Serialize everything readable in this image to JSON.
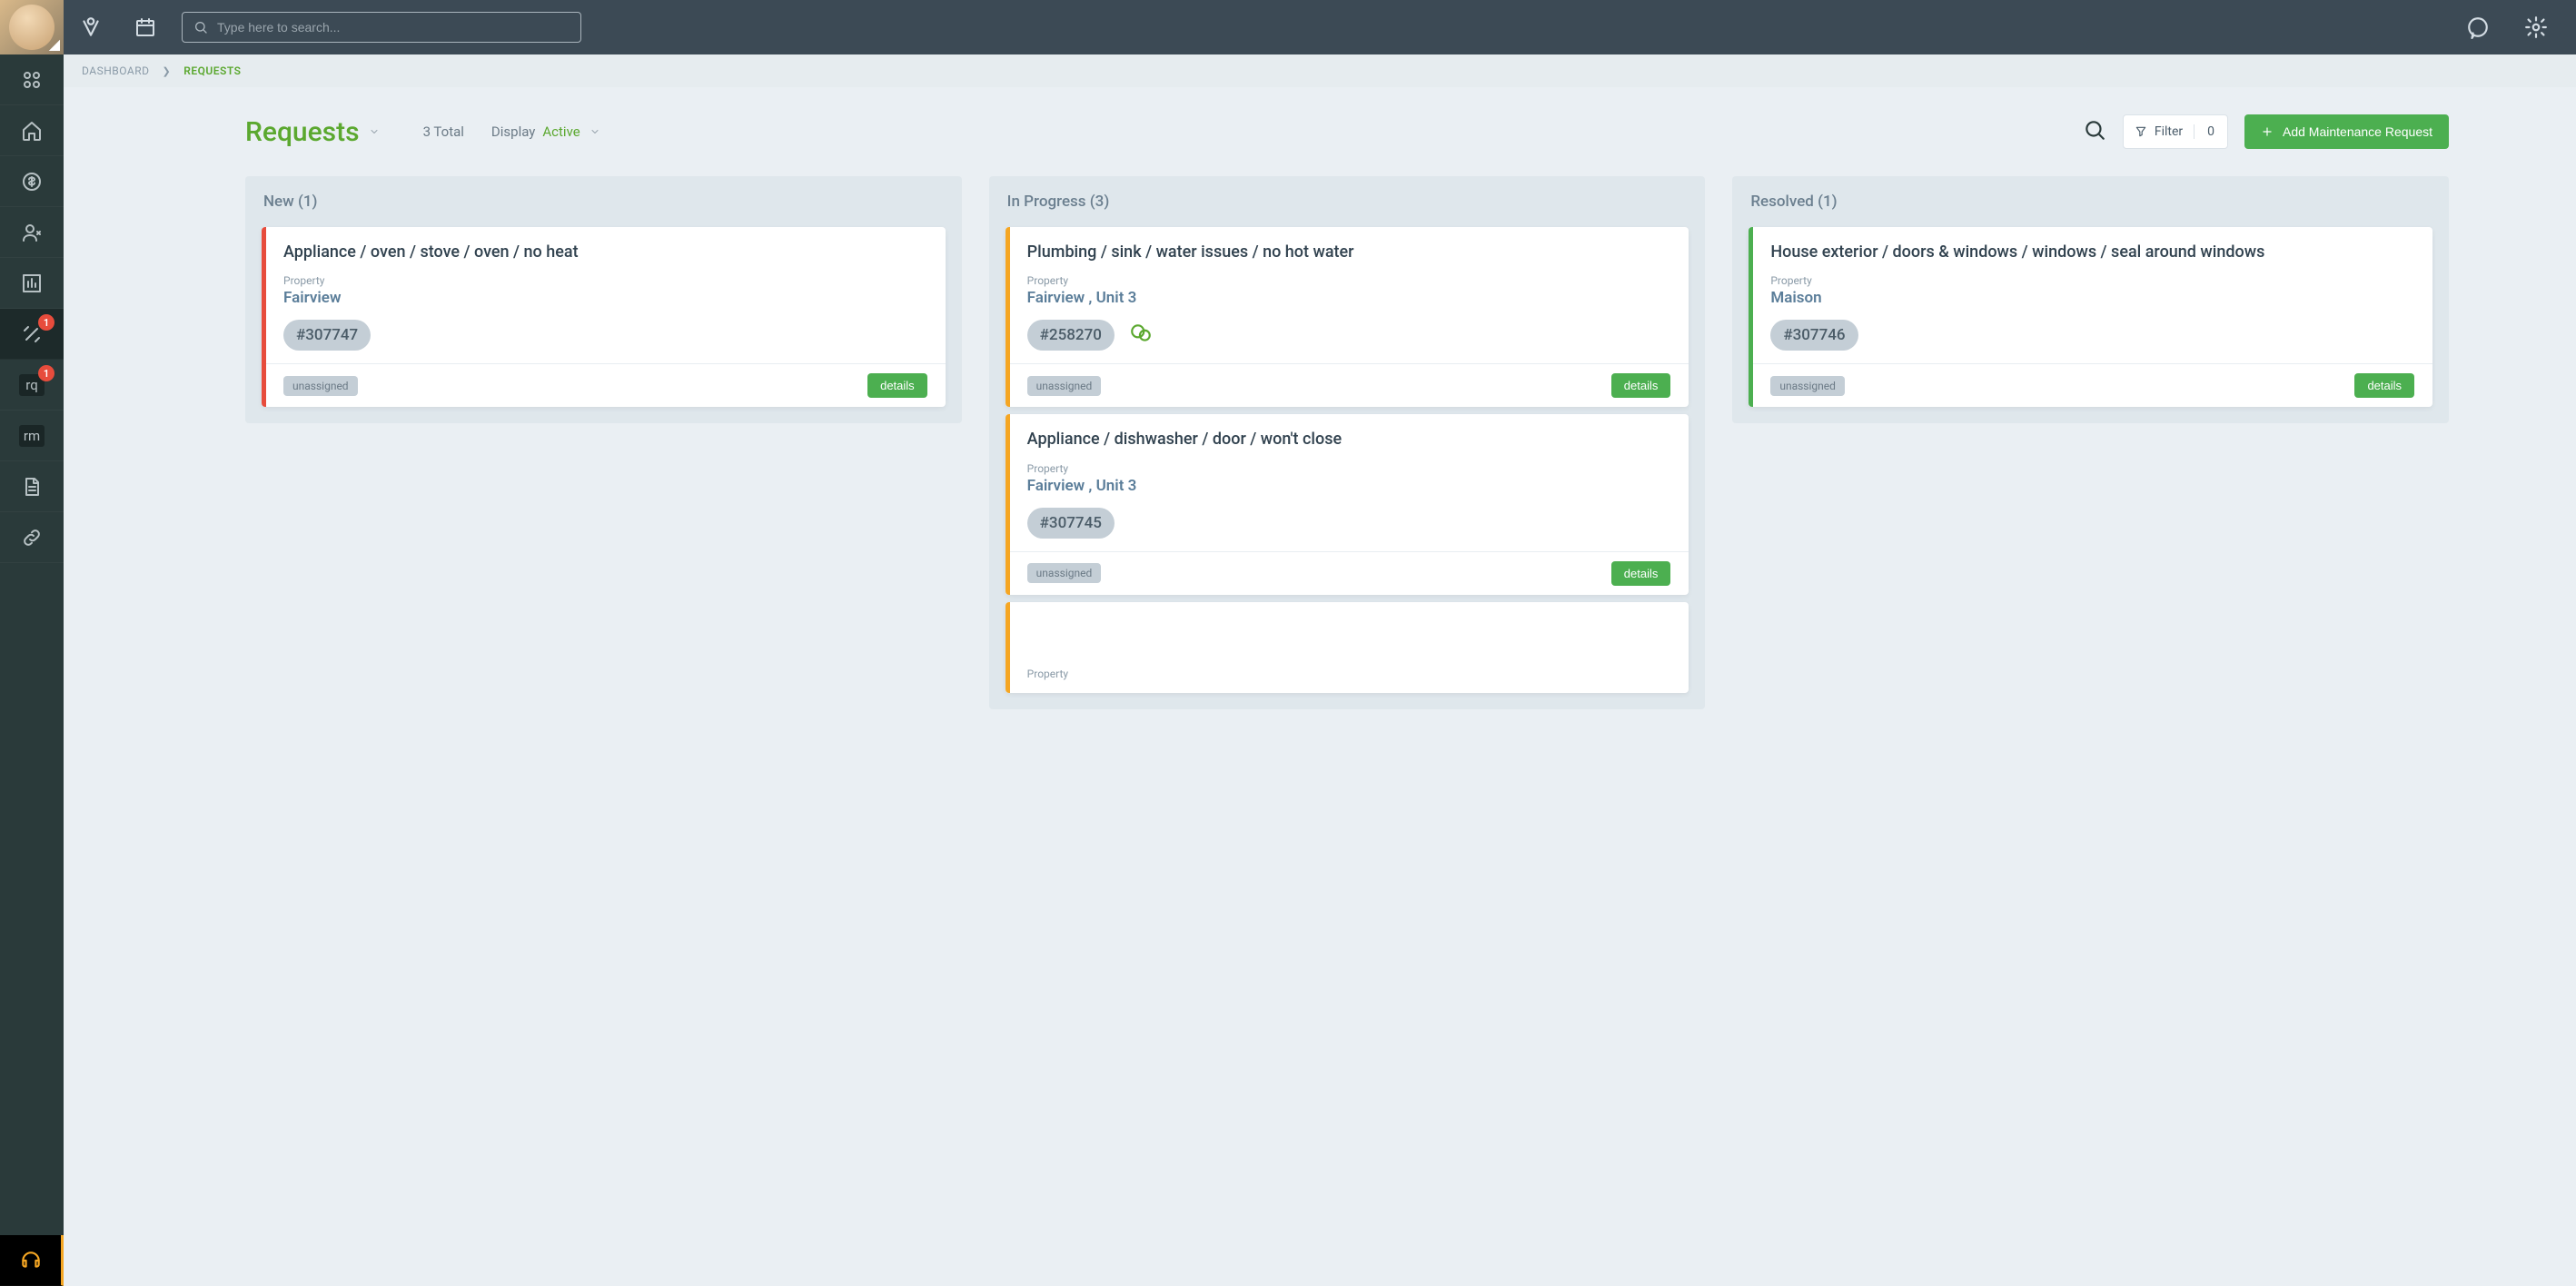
{
  "topbar": {
    "search_placeholder": "Type here to search..."
  },
  "sidebar": {
    "items": [
      {
        "name": "apps",
        "badge": null
      },
      {
        "name": "home",
        "badge": null
      },
      {
        "name": "money",
        "badge": null
      },
      {
        "name": "people",
        "badge": null
      },
      {
        "name": "reports",
        "badge": null
      },
      {
        "name": "maintenance",
        "badge": "1"
      },
      {
        "name": "rq",
        "abbr": "rq",
        "badge": "1"
      },
      {
        "name": "rm",
        "abbr": "rm",
        "badge": null
      },
      {
        "name": "documents",
        "badge": null
      },
      {
        "name": "links",
        "badge": null
      }
    ]
  },
  "breadcrumb": {
    "root": "DASHBOARD",
    "current": "REQUESTS"
  },
  "header": {
    "title": "Requests",
    "total": "3 Total",
    "display_label": "Display",
    "display_value": "Active",
    "filter_label": "Filter",
    "filter_count": "0",
    "add_label": "Add Maintenance Request"
  },
  "columns": [
    {
      "title": "New (1)",
      "stripe": "#e74c3c",
      "cards": [
        {
          "title": "Appliance / oven / stove / oven / no heat",
          "property_label": "Property",
          "property": "Fairview",
          "id": "#307747",
          "has_chat": false,
          "assignee": "unassigned",
          "details": "details"
        }
      ]
    },
    {
      "title": "In Progress (3)",
      "stripe": "#f5a623",
      "cards": [
        {
          "title": "Plumbing / sink / water issues / no hot water",
          "property_label": "Property",
          "property": "Fairview , Unit 3",
          "id": "#258270",
          "has_chat": true,
          "assignee": "unassigned",
          "details": "details"
        },
        {
          "title": "Appliance / dishwasher / door / won't close",
          "property_label": "Property",
          "property": "Fairview , Unit 3",
          "id": "#307745",
          "has_chat": false,
          "assignee": "unassigned",
          "details": "details"
        },
        {
          "title": "",
          "property_label": "Property",
          "property": "",
          "id": "",
          "has_chat": false,
          "assignee": "",
          "details": "",
          "partial": true
        }
      ]
    },
    {
      "title": "Resolved (1)",
      "stripe": "#4caf50",
      "cards": [
        {
          "title": "House exterior / doors & windows / windows / seal around windows",
          "property_label": "Property",
          "property": "Maison",
          "id": "#307746",
          "has_chat": false,
          "assignee": "unassigned",
          "details": "details"
        }
      ]
    }
  ]
}
